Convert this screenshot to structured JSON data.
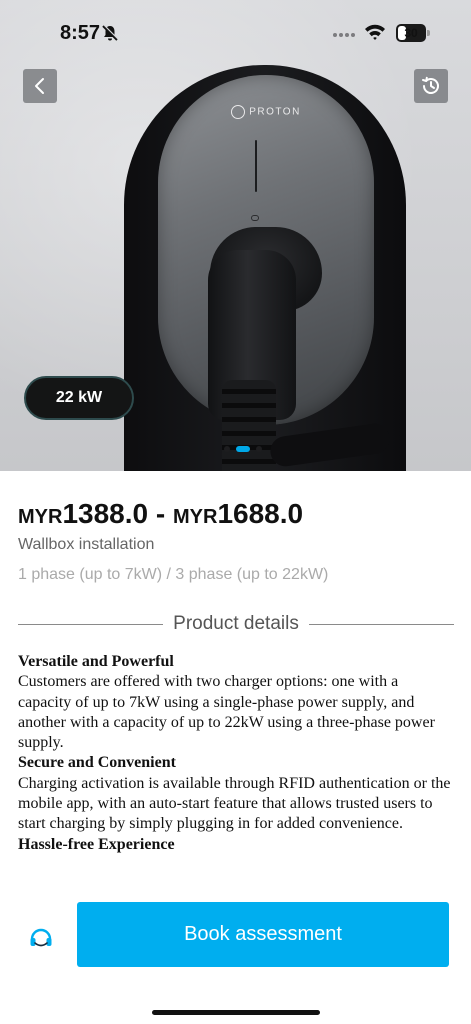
{
  "status_bar": {
    "time": "8:57",
    "battery_level": "30",
    "battery_fraction": 0.3
  },
  "hero": {
    "brand_text": "PROTON",
    "power_chip": "22 kW",
    "carousel": {
      "count": 3,
      "active_index": 1
    },
    "icons": {
      "back": "chevron-left-icon",
      "history": "history-clock-icon"
    }
  },
  "product": {
    "price_currency_1": "MYR",
    "price_value_1": "1388.0",
    "price_separator": " - ",
    "price_currency_2": "MYR",
    "price_value_2": "1688.0",
    "subtitle": "Wallbox installation",
    "variant": "1 phase (up to 7kW) / 3 phase (up to 22kW)"
  },
  "details": {
    "section_title": "Product details",
    "blocks": [
      {
        "heading": "Versatile and Powerful",
        "body": "Customers are offered with two charger options: one with a capacity of up to 7kW using a single-phase power supply, and another with a capacity of up to 22kW using a three-phase power supply."
      },
      {
        "heading": "Secure and Convenient",
        "body": "Charging activation is available through RFID authentication or the mobile app, with an auto-start feature that allows trusted users to start charging by simply plugging in for added convenience."
      },
      {
        "heading": "Hassle-free Experience",
        "body": ""
      }
    ]
  },
  "footer": {
    "support_icon": "headset-icon",
    "book_label": "Book assessment"
  },
  "colors": {
    "accent": "#00aeef",
    "carousel_active": "#00a8e8",
    "chip_bg": "#141515"
  }
}
